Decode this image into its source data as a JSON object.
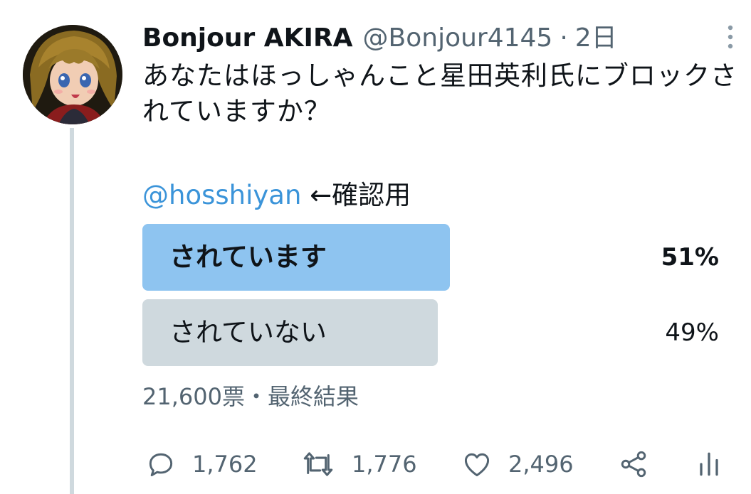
{
  "author": {
    "display_name": "Bonjour AKIRA",
    "handle": "@Bonjour4145",
    "separator": "·",
    "time": "2日"
  },
  "tweet": {
    "text": "あなたはほっしゃんこと星田英利氏にブロックされていますか？",
    "mention": "@hosshiyan",
    "mention_suffix": " ←確認用"
  },
  "poll": {
    "options": [
      {
        "label": "されています",
        "percent_text": "51%",
        "percent": 51,
        "winner": true,
        "color": "#8ec4f0"
      },
      {
        "label": "されていない",
        "percent_text": "49%",
        "percent": 49,
        "winner": false,
        "color": "#cfd9de"
      }
    ],
    "votes": "21,600票",
    "meta_sep": "・",
    "status": "最終結果"
  },
  "actions": {
    "reply": {
      "icon": "reply-icon",
      "count": "1,762"
    },
    "retweet": {
      "icon": "retweet-icon",
      "count": "1,776"
    },
    "like": {
      "icon": "heart-icon",
      "count": "2,496"
    },
    "share": {
      "icon": "share-icon"
    },
    "analytics": {
      "icon": "analytics-icon"
    }
  },
  "colors": {
    "text": "#0f1419",
    "muted": "#536471",
    "link": "#3b94d9",
    "thread_line": "#cfd9de"
  }
}
